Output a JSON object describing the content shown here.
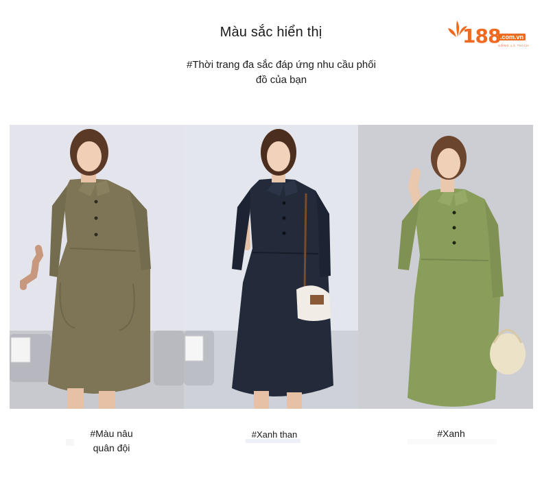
{
  "header": {
    "title": "Màu sắc hiển thị",
    "subtitle_line1": "#Thời trang đa sắc đáp ứng nhu cầu phối",
    "subtitle_line2": "đồ của bạn"
  },
  "logo": {
    "number": "188",
    "domain": ".com.vn",
    "tagline": "SỐNG LÀ THÍCH"
  },
  "products": [
    {
      "caption_line1": "#Màu nâu",
      "caption_line2": "quân đội",
      "dress_color": "#7d7556"
    },
    {
      "caption_line1": "#Xanh than",
      "dress_color": "#232b3b"
    },
    {
      "caption_line1": "#Xanh",
      "dress_color": "#8a9e5c"
    }
  ],
  "colors": {
    "brand": "#f06a22"
  }
}
